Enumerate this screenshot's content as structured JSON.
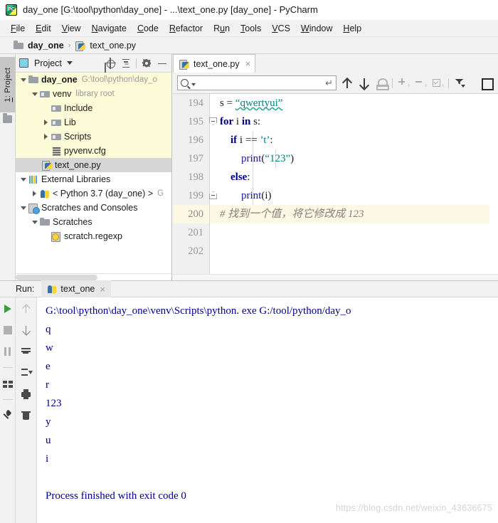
{
  "window": {
    "title": "day_one [G:\\tool\\python\\day_one] - ...\\text_one.py [day_one] - PyCharm",
    "logo_label": "PC"
  },
  "menubar": {
    "items": [
      {
        "label": "File",
        "mnemonic": "F"
      },
      {
        "label": "Edit",
        "mnemonic": "E"
      },
      {
        "label": "View",
        "mnemonic": "V"
      },
      {
        "label": "Navigate",
        "mnemonic": "N"
      },
      {
        "label": "Code",
        "mnemonic": "C"
      },
      {
        "label": "Refactor",
        "mnemonic": "R"
      },
      {
        "label": "Run",
        "mnemonic": "u"
      },
      {
        "label": "Tools",
        "mnemonic": "T"
      },
      {
        "label": "VCS",
        "mnemonic": "V"
      },
      {
        "label": "Window",
        "mnemonic": "W"
      },
      {
        "label": "Help",
        "mnemonic": "H"
      }
    ]
  },
  "breadcrumb": {
    "project": "day_one",
    "separator": "›",
    "file": "text_one.py"
  },
  "left_strip": {
    "tab_prefix": "1",
    "tab_label": ": Project"
  },
  "project_panel": {
    "title": "Project",
    "icons": [
      "locate-icon",
      "collapse-all-icon",
      "gear-icon",
      "minimize-icon"
    ],
    "tree": [
      {
        "label": "day_one",
        "path": "G:\\tool\\python\\day_o",
        "icon": "folder-icon",
        "indent": 0,
        "twist": "open",
        "bold": true,
        "highlight": "yellow"
      },
      {
        "label": "venv",
        "badge": "library root",
        "icon": "folder-library-icon",
        "indent": 1,
        "twist": "open",
        "highlight": "yellow"
      },
      {
        "label": "Include",
        "icon": "folder-library-icon",
        "indent": 2,
        "twist": "none",
        "highlight": "yellow"
      },
      {
        "label": "Lib",
        "icon": "folder-library-icon",
        "indent": 2,
        "twist": "closed",
        "highlight": "yellow"
      },
      {
        "label": "Scripts",
        "icon": "folder-library-icon",
        "indent": 2,
        "twist": "closed",
        "highlight": "yellow"
      },
      {
        "label": "pyvenv.cfg",
        "icon": "config-file-icon",
        "indent": 2,
        "twist": "none",
        "highlight": "yellow"
      },
      {
        "label": "text_one.py",
        "icon": "python-file-icon",
        "indent": 1,
        "twist": "none",
        "highlight": "gray"
      },
      {
        "label": "External Libraries",
        "icon": "external-libraries-icon",
        "indent": 0,
        "twist": "open"
      },
      {
        "label": "< Python 3.7 (day_one) >",
        "badge": "G",
        "icon": "python-icon",
        "indent": 1,
        "twist": "closed"
      },
      {
        "label": "Scratches and Consoles",
        "icon": "scratches-icon",
        "indent": 0,
        "twist": "open"
      },
      {
        "label": "Scratches",
        "icon": "folder-icon",
        "indent": 1,
        "twist": "open"
      },
      {
        "label": "scratch.regexp",
        "icon": "regexp-file-icon",
        "indent": 2,
        "twist": "none"
      }
    ]
  },
  "editor": {
    "tab": {
      "label": "text_one.py",
      "close": "×",
      "icon": "python-file-icon"
    },
    "find_toolbar": {
      "search_value": "",
      "search_placeholder": "",
      "return_glyph": "↵",
      "icons": [
        "search-icon",
        "arrow-up-icon",
        "arrow-down-icon",
        "stamp-icon",
        "add-icon",
        "remove-icon",
        "checked-icon",
        "filter-icon",
        "square-icon"
      ]
    },
    "lines": [
      {
        "num": "194",
        "current": false,
        "tokens": [
          {
            "t": "s = ",
            "c": "plain"
          },
          {
            "t": "“qwertyui”",
            "c": "str wavy"
          }
        ]
      },
      {
        "num": "195",
        "current": false,
        "fold": "top",
        "tokens": [
          {
            "t": "for",
            "c": "kw"
          },
          {
            "t": " i ",
            "c": "plain"
          },
          {
            "t": "in",
            "c": "kw"
          },
          {
            "t": " s:",
            "c": "plain"
          }
        ]
      },
      {
        "num": "196",
        "current": false,
        "tokens": [
          {
            "t": "    ",
            "c": "plain"
          },
          {
            "t": "if",
            "c": "kw"
          },
          {
            "t": " i == ",
            "c": "plain"
          },
          {
            "t": "’t’",
            "c": "str"
          },
          {
            "t": ":",
            "c": "plain"
          }
        ]
      },
      {
        "num": "197",
        "current": false,
        "tokens": [
          {
            "t": "        ",
            "c": "plain"
          },
          {
            "t": "print",
            "c": "fn"
          },
          {
            "t": "(",
            "c": "plain"
          },
          {
            "t": "“123”",
            "c": "str"
          },
          {
            "t": ")",
            "c": "plain"
          }
        ]
      },
      {
        "num": "198",
        "current": false,
        "tokens": [
          {
            "t": "    ",
            "c": "plain"
          },
          {
            "t": "else",
            "c": "kw"
          },
          {
            "t": ":",
            "c": "plain"
          }
        ]
      },
      {
        "num": "199",
        "current": false,
        "fold": "bot",
        "tokens": [
          {
            "t": "        ",
            "c": "plain"
          },
          {
            "t": "print",
            "c": "fn"
          },
          {
            "t": "(i)",
            "c": "plain"
          }
        ]
      },
      {
        "num": "200",
        "current": true,
        "tokens": [
          {
            "t": "# 找到一个值，将它修改成 123",
            "c": "cmt"
          }
        ]
      },
      {
        "num": "201",
        "current": false,
        "tokens": []
      },
      {
        "num": "202",
        "current": false,
        "tokens": []
      }
    ]
  },
  "run_panel": {
    "label": "Run:",
    "tab": {
      "label": "text_one",
      "close": "×",
      "icon": "python-icon"
    },
    "toolbar_left": [
      "run-icon",
      "stop-icon",
      "pause-icon",
      "layout-icon",
      "pin-icon"
    ],
    "toolbar_right": [
      "soft-wrap-icon",
      "scroll-to-end-icon",
      "print-icon",
      "clear-all-icon"
    ],
    "toolbar_right_arrows": [
      "arrow-up-icon",
      "arrow-down-icon"
    ],
    "console_lines": [
      "G:\\tool\\python\\day_one\\venv\\Scripts\\python. exe G:/tool/python/day_o",
      "q",
      "w",
      "e",
      "r",
      "123",
      "y",
      "u",
      "i",
      "",
      "Process finished with exit code 0"
    ],
    "watermark": "https://blog.csdn.net/weixin_43636675"
  },
  "colors": {
    "keyword": "#000080",
    "string": "#008080",
    "comment": "#808080",
    "console_text": "#000080",
    "current_line": "#fdf8e3",
    "tree_highlight": "#fbfbd8",
    "tree_selected": "#d6d6d6",
    "run_icon": "#3c9d3c"
  }
}
